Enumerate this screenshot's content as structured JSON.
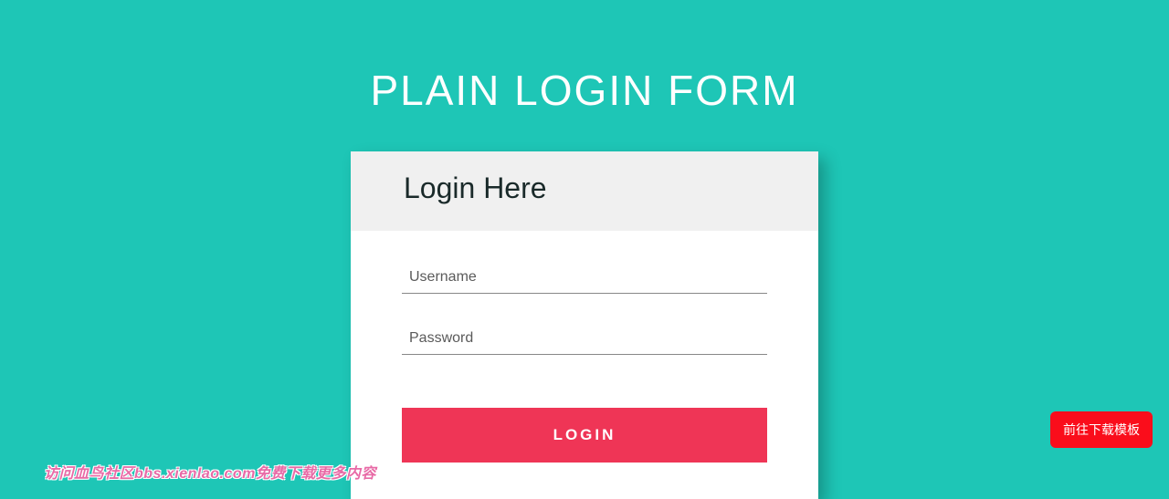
{
  "page": {
    "title": "PLAIN LOGIN FORM"
  },
  "card": {
    "header": "Login Here",
    "username": {
      "placeholder": "Username",
      "value": ""
    },
    "password": {
      "placeholder": "Password",
      "value": ""
    },
    "login_button": "LOGIN"
  },
  "download_button": "前往下载模板",
  "watermark": "访问血鸟社区bbs.xienlao.com免费下载更多内容",
  "colors": {
    "background": "#1ec6b6",
    "accent": "#ef3556",
    "download": "#fa0d1b"
  }
}
